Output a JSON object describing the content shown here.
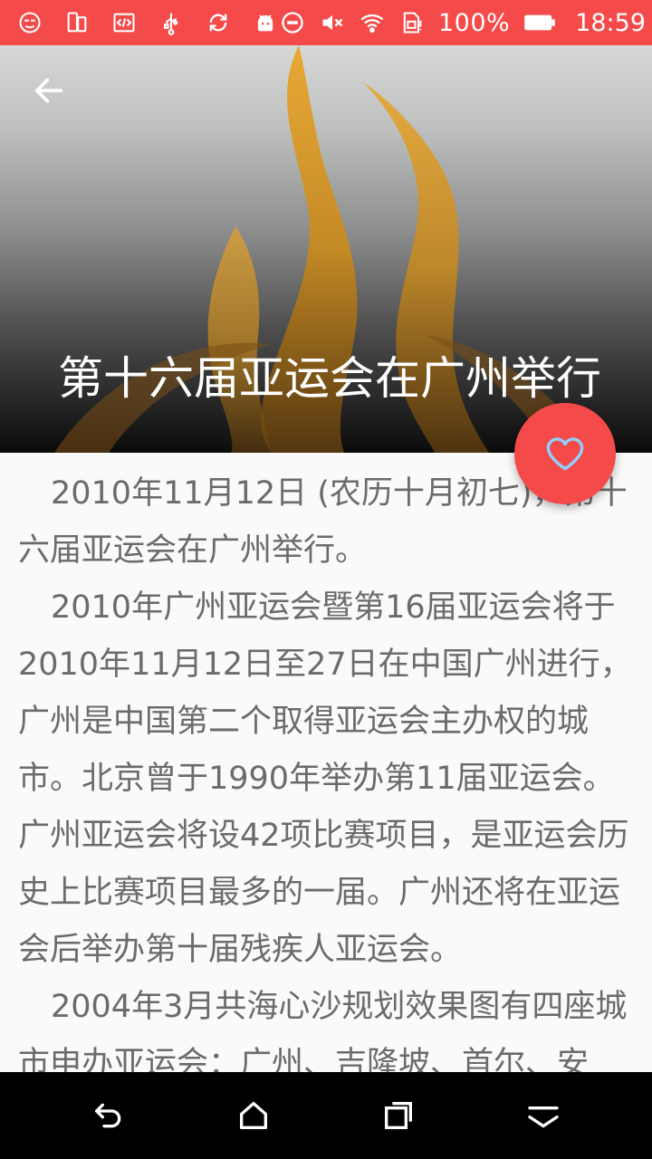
{
  "status_bar": {
    "battery_text": "100%",
    "time": "18:59",
    "icons_left": [
      "emoji-icon",
      "phone-transfer-icon",
      "code-icon",
      "usb-icon",
      "sync-icon",
      "android-icon"
    ],
    "icons_right": [
      "do-not-disturb-icon",
      "mute-icon",
      "wifi-icon",
      "sim-alert-icon",
      "battery-icon"
    ]
  },
  "header": {
    "title": "第十六届亚运会在广州举行",
    "back_icon": "arrow-back-icon"
  },
  "fab": {
    "icon": "heart-icon",
    "color": "#f44a4a"
  },
  "article": {
    "paragraphs": [
      "2010年11月12日 (农历十月初七)，第十六届亚运会在广州举行。",
      "2010年广州亚运会暨第16届亚运会将于2010年11月12日至27日在中国广州进行，广州是中国第二个取得亚运会主办权的城市。北京曾于1990年举办第11届亚运会。广州亚运会将设42项比赛项目，是亚运会历史上比赛项目最多的一届。广州还将在亚运会后举办第十届残疾人亚运会。",
      "2004年3月共海心沙规划效果图有四座城市申办亚运会：广州、吉隆坡、首尔、安"
    ]
  },
  "nav_bar": {
    "buttons": [
      "back-nav-icon",
      "home-icon",
      "recents-icon",
      "notifications-icon"
    ]
  },
  "colors": {
    "accent": "#f44a4a",
    "text": "#6b6b6b",
    "background": "#fafafa"
  }
}
